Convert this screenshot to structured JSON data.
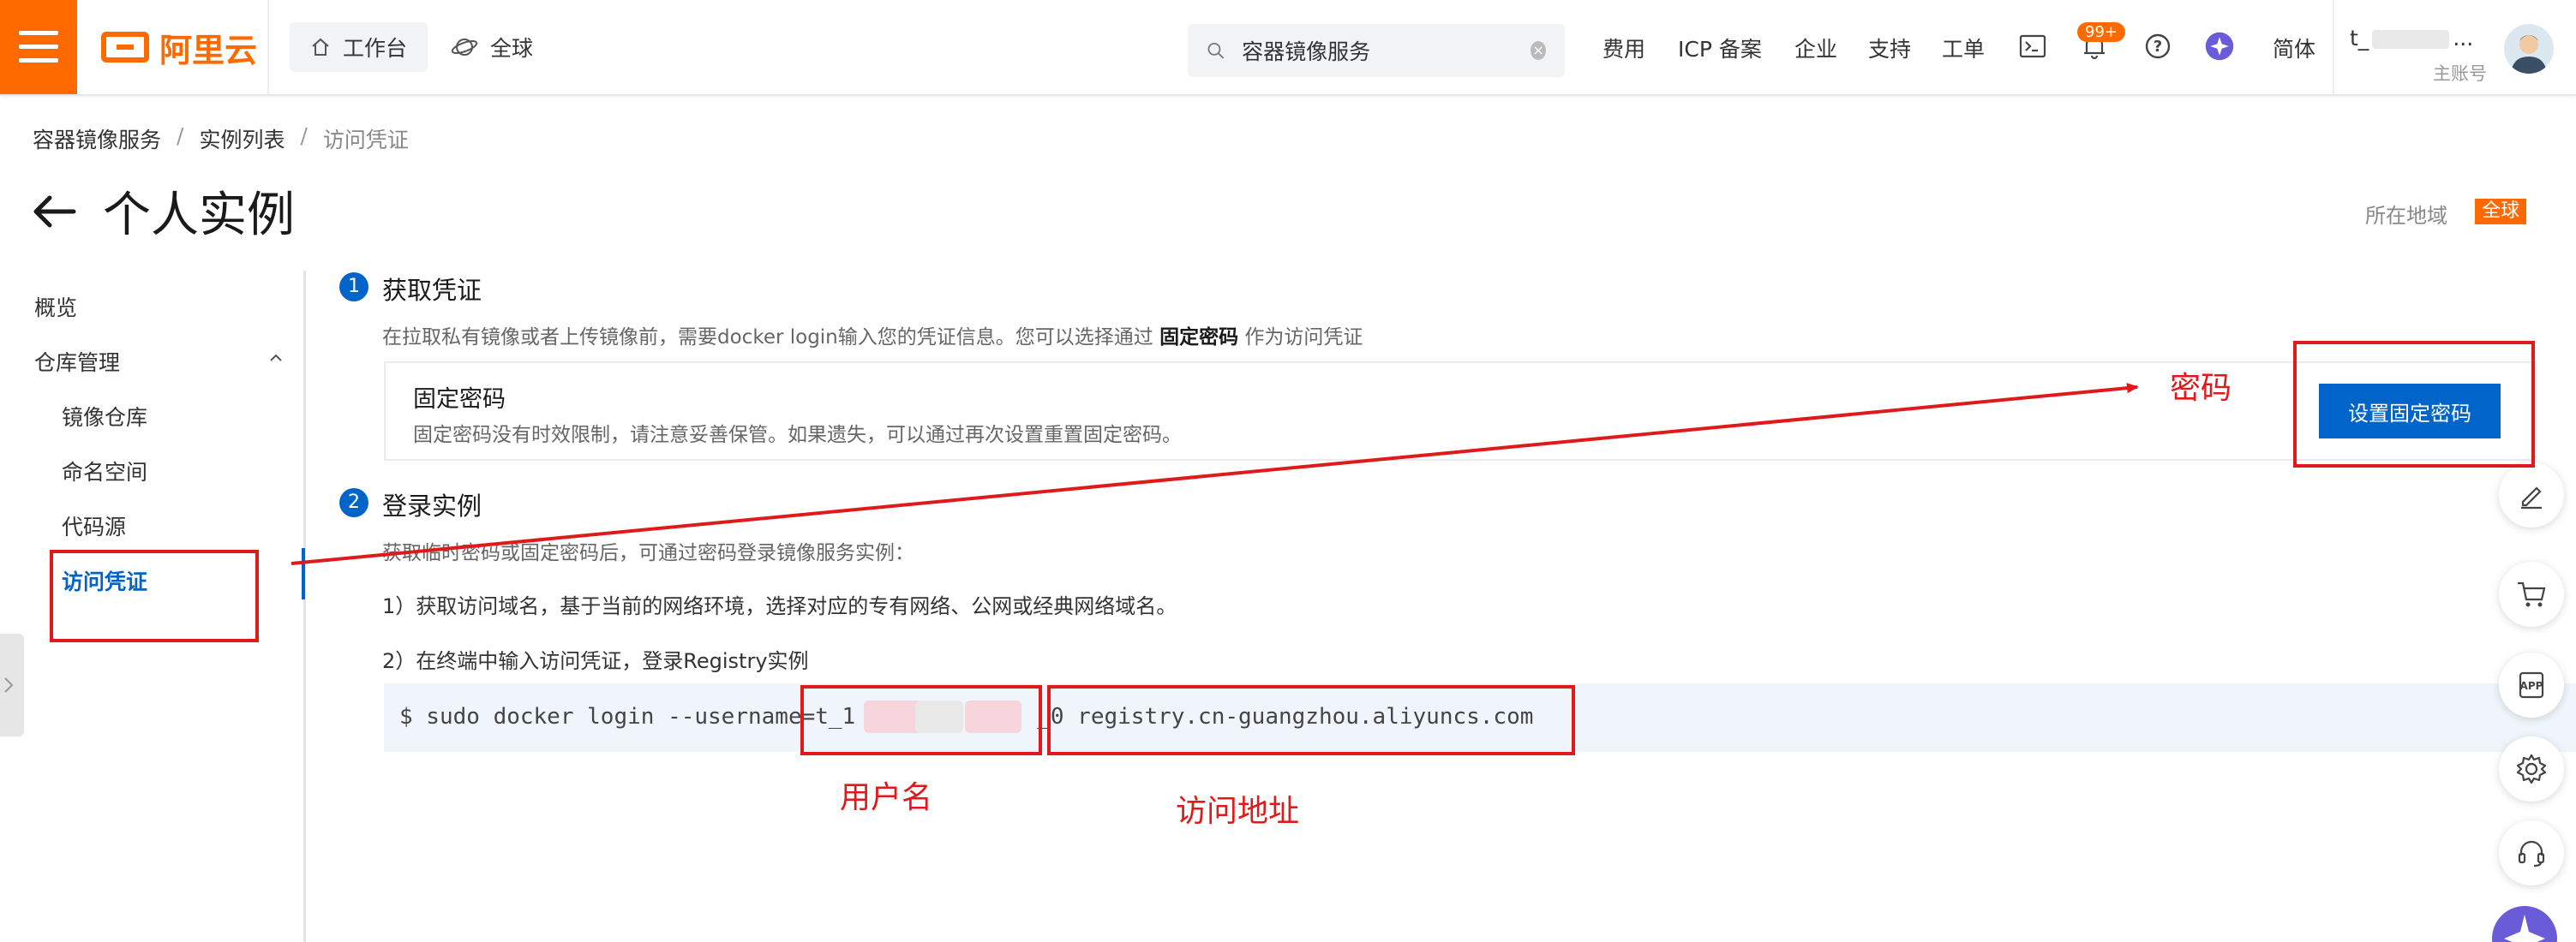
{
  "header": {
    "brand": "阿里云",
    "workbench": "工作台",
    "global": "全球",
    "search_placeholder": "容器镜像服务",
    "links": [
      "费用",
      "ICP 备案",
      "企业",
      "支持",
      "工单"
    ],
    "notification_badge": "99+",
    "language": "简体",
    "user_name": "t_",
    "user_name_trail": "...",
    "user_role": "主账号"
  },
  "breadcrumb": [
    "容器镜像服务",
    "实例列表",
    "访问凭证"
  ],
  "page": {
    "title": "个人实例",
    "region_label": "所在地域",
    "region_value": "全球"
  },
  "sidebar": {
    "items": [
      {
        "label": "概览"
      },
      {
        "label": "仓库管理"
      },
      {
        "label": "镜像仓库"
      },
      {
        "label": "命名空间"
      },
      {
        "label": "代码源"
      },
      {
        "label": "访问凭证"
      }
    ]
  },
  "content": {
    "step1": {
      "number": "1",
      "title": "获取凭证",
      "desc_pre": "在拉取私有镜像或者上传镜像前，需要docker login输入您的凭证信息。您可以选择通过 ",
      "desc_bold": "固定密码",
      "desc_post": " 作为访问凭证",
      "card_title": "固定密码",
      "card_desc": "固定密码没有时效限制，请注意妥善保管。如果遗失，可以通过再次设置重置固定密码。",
      "button": "设置固定密码"
    },
    "step2": {
      "number": "2",
      "title": "登录实例",
      "desc": "获取临时密码或固定密码后，可通过密码登录镜像服务实例：",
      "line1": "1）获取访问域名，基于当前的网络环境，选择对应的专有网络、公网或经典网络域名。",
      "line2": "2）在终端中输入访问凭证，登录Registry实例",
      "command_prefix": "$ sudo docker login --username=t_1",
      "command_suffix": "_0 registry.cn-guangzhou.aliyuncs.com"
    }
  },
  "annotations": {
    "password": "密码",
    "username": "用户名",
    "address": "访问地址"
  },
  "colors": {
    "brand": "#ff6a00",
    "primary": "#0064c8",
    "annotation": "#e01a1a"
  }
}
